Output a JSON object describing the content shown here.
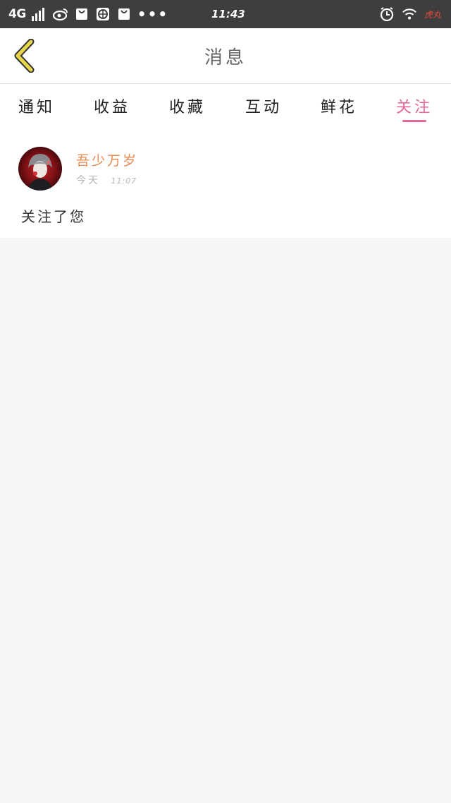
{
  "status_bar": {
    "network": "4G",
    "time": "11:43",
    "battery_text": "虎丸",
    "icons": [
      "signal-icon",
      "weibo-icon",
      "shopping-bag-icon",
      "browser-icon",
      "shopping-bag-icon",
      "more-dots-icon",
      "alarm-icon",
      "wifi-icon"
    ],
    "more_dots": "•••"
  },
  "header": {
    "title": "消息",
    "back_icon": "chevron-left-icon",
    "back_color": "#e7d64a"
  },
  "tabs": [
    {
      "label": "通知",
      "active": false
    },
    {
      "label": "收益",
      "active": false
    },
    {
      "label": "收藏",
      "active": false
    },
    {
      "label": "互动",
      "active": false
    },
    {
      "label": "鲜花",
      "active": false
    },
    {
      "label": "关注",
      "active": true
    }
  ],
  "messages": [
    {
      "user_name": "吾少万岁",
      "date": "今天",
      "time": "11:07",
      "text": "关注了您"
    }
  ],
  "colors": {
    "accent": "#e46a9a",
    "username": "#e8874f",
    "status_bar_bg": "#3e3e3e",
    "page_bg": "#f6f6f6"
  }
}
